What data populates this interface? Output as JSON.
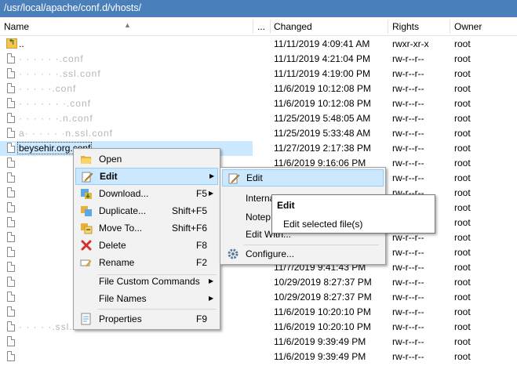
{
  "path": "/usr/local/apache/conf.d/vhosts/",
  "columns": {
    "name": "Name",
    "ext": "...",
    "changed": "Changed",
    "rights": "Rights",
    "owner": "Owner"
  },
  "files": [
    {
      "name": "..",
      "changed": "11/11/2019 4:09:41 AM",
      "rights": "rwxr-xr-x",
      "owner": "root",
      "icon": "parent-dir-icon"
    },
    {
      "name": "· · · · · ·.conf",
      "changed": "11/11/2019 4:21:04 PM",
      "rights": "rw-r--r--",
      "owner": "root",
      "icon": "file-icon"
    },
    {
      "name": "· · · · · ·.ssl.conf",
      "changed": "11/11/2019 4:19:00 PM",
      "rights": "rw-r--r--",
      "owner": "root",
      "icon": "file-icon"
    },
    {
      "name": "· · · · ·.conf",
      "changed": "11/6/2019 10:12:08 PM",
      "rights": "rw-r--r--",
      "owner": "root",
      "icon": "file-icon"
    },
    {
      "name": "· · · · · · ·.conf",
      "changed": "11/6/2019 10:12:08 PM",
      "rights": "rw-r--r--",
      "owner": "root",
      "icon": "file-icon"
    },
    {
      "name": "· · · · · ·.n.conf",
      "changed": "11/25/2019 5:48:05 AM",
      "rights": "rw-r--r--",
      "owner": "root",
      "icon": "file-icon"
    },
    {
      "name": "a· · · · · ·n.ssl.conf",
      "changed": "11/25/2019 5:33:48 AM",
      "rights": "rw-r--r--",
      "owner": "root",
      "icon": "file-icon"
    },
    {
      "name": "beysehir.org.conf",
      "changed": "11/27/2019 2:17:38 PM",
      "rights": "rw-r--r--",
      "owner": "root",
      "icon": "file-icon",
      "selected": true
    },
    {
      "name": "",
      "changed": "11/6/2019 9:16:06 PM",
      "rights": "rw-r--r--",
      "owner": "root",
      "icon": "file-icon"
    },
    {
      "name": "",
      "changed": "",
      "rights": "rw-r--r--",
      "owner": "root",
      "icon": "file-icon"
    },
    {
      "name": "",
      "changed": "",
      "rights": "rw-r--r--",
      "owner": "root",
      "icon": "file-icon"
    },
    {
      "name": "",
      "changed": "",
      "rights": "rw-r--r--",
      "owner": "root",
      "icon": "file-icon"
    },
    {
      "name": "",
      "changed": "",
      "rights": "rw-r--r--",
      "owner": "root",
      "icon": "file-icon"
    },
    {
      "name": "",
      "changed": "",
      "rights": "rw-r--r--",
      "owner": "root",
      "icon": "file-icon"
    },
    {
      "name": "",
      "changed": "",
      "rights": "rw-r--r--",
      "owner": "root",
      "icon": "file-icon"
    },
    {
      "name": "",
      "changed": "11/7/2019 9:41:43 PM",
      "rights": "rw-r--r--",
      "owner": "root",
      "icon": "file-icon"
    },
    {
      "name": "",
      "changed": "10/29/2019 8:27:37 PM",
      "rights": "rw-r--r--",
      "owner": "root",
      "icon": "file-icon"
    },
    {
      "name": "",
      "changed": "10/29/2019 8:27:37 PM",
      "rights": "rw-r--r--",
      "owner": "root",
      "icon": "file-icon"
    },
    {
      "name": "",
      "changed": "11/6/2019 10:20:10 PM",
      "rights": "rw-r--r--",
      "owner": "root",
      "icon": "file-icon"
    },
    {
      "name": "· · · · ·.ssl.conf",
      "changed": "11/6/2019 10:20:10 PM",
      "rights": "rw-r--r--",
      "owner": "root",
      "icon": "file-icon"
    },
    {
      "name": "",
      "changed": "11/6/2019 9:39:49 PM",
      "rights": "rw-r--r--",
      "owner": "root",
      "icon": "file-icon"
    },
    {
      "name": "",
      "changed": "11/6/2019 9:39:49 PM",
      "rights": "rw-r--r--",
      "owner": "root",
      "icon": "file-icon"
    }
  ],
  "context_menu": {
    "open": "Open",
    "edit": "Edit",
    "download": "Download...",
    "download_key": "F5",
    "duplicate": "Duplicate...",
    "duplicate_key": "Shift+F5",
    "move": "Move To...",
    "move_key": "Shift+F6",
    "delete": "Delete",
    "delete_key": "F8",
    "rename": "Rename",
    "rename_key": "F2",
    "custom": "File Custom Commands",
    "filenames": "File Names",
    "properties": "Properties",
    "properties_key": "F9"
  },
  "edit_submenu": {
    "edit": "Edit",
    "internal": "Interna",
    "notepad": "Notep",
    "edit_with": "Edit With...",
    "configure": "Configure..."
  },
  "tooltip": {
    "title": "Edit",
    "description": "Edit selected file(s)"
  },
  "colors": {
    "path_bar": "#4a7fba",
    "highlight": "#cce8ff",
    "highlight_border": "#99ccf5"
  }
}
